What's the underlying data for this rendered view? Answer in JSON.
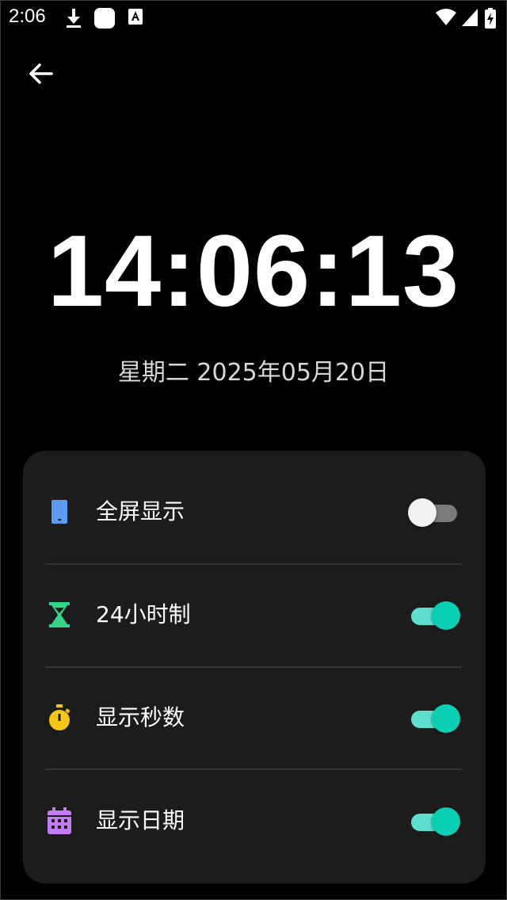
{
  "status_bar": {
    "time": "2:06",
    "icons": [
      "download-icon",
      "app-icon",
      "text-icon",
      "wifi-icon",
      "signal-icon",
      "battery-charging-icon"
    ]
  },
  "header": {
    "back_icon": "arrow-left-icon"
  },
  "clock": {
    "time": "14:06:13",
    "date": "星期二 2025年05月20日"
  },
  "settings": [
    {
      "label": "全屏显示",
      "icon": "phone-icon",
      "icon_color": "#5b9cf0",
      "enabled": false
    },
    {
      "label": "24小时制",
      "icon": "hourglass-icon",
      "icon_color": "#35d48a",
      "enabled": true
    },
    {
      "label": "显示秒数",
      "icon": "stopwatch-icon",
      "icon_color": "#f7c518",
      "enabled": true
    },
    {
      "label": "显示日期",
      "icon": "calendar-icon",
      "icon_color": "#c07cf0",
      "enabled": true
    }
  ],
  "colors": {
    "background": "#000000",
    "card": "#1c1c1c",
    "toggle_on": "#0bcfb4",
    "toggle_on_track": "#5fe0cf",
    "toggle_off_thumb": "#f2f2f2",
    "toggle_off_track": "#7b7b7b"
  }
}
